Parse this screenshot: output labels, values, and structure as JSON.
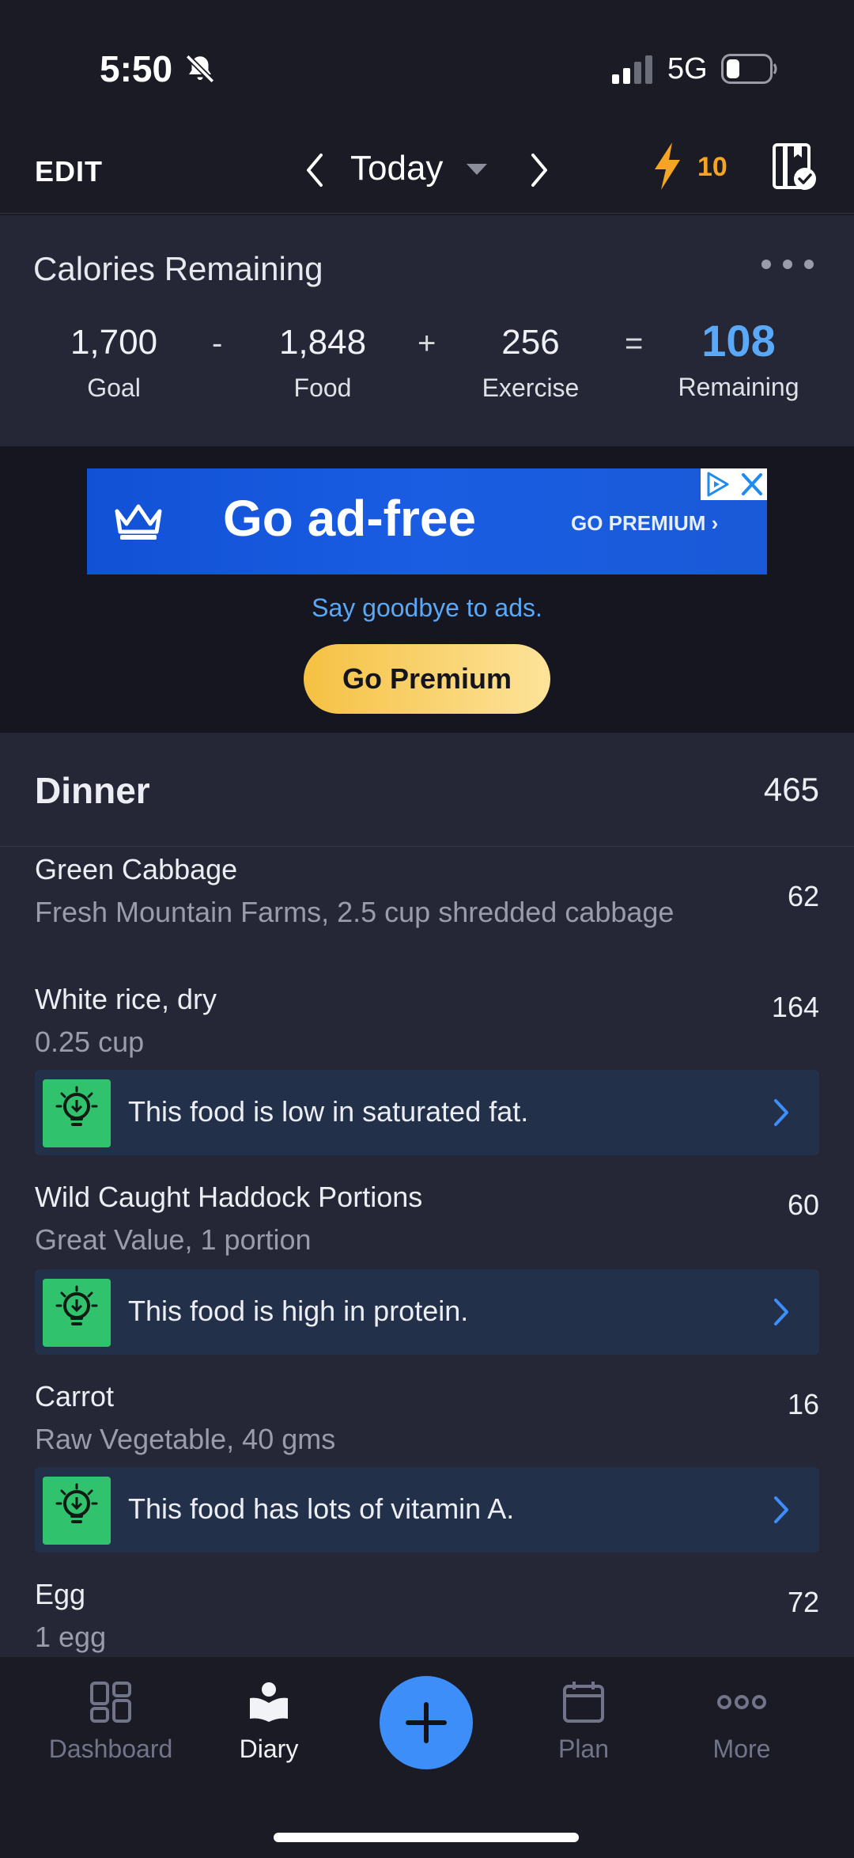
{
  "status_bar": {
    "time": "5:50",
    "network": "5G"
  },
  "header": {
    "edit_label": "EDIT",
    "date_label": "Today",
    "streak_count": "10"
  },
  "calories": {
    "title": "Calories Remaining",
    "goal": {
      "value": "1,700",
      "label": "Goal"
    },
    "food": {
      "value": "1,848",
      "label": "Food"
    },
    "exercise": {
      "value": "256",
      "label": "Exercise"
    },
    "remaining": {
      "value": "108",
      "label": "Remaining"
    },
    "op_minus": "-",
    "op_plus": "+",
    "op_equals": "="
  },
  "ad": {
    "banner_text": "Go ad-free",
    "banner_cta": "GO PREMIUM",
    "tagline": "Say goodbye to ads.",
    "button_label": "Go Premium"
  },
  "meal": {
    "title": "Dinner",
    "calories": "465",
    "items": [
      {
        "name": "Green Cabbage",
        "description": "Fresh Mountain Farms, 2.5 cup shredded cabbage",
        "calories": "62"
      },
      {
        "name": "White rice, dry",
        "description": "0.25 cup",
        "calories": "164",
        "tip": "This food is low in saturated fat."
      },
      {
        "name": "Wild Caught Haddock Portions",
        "description": "Great Value, 1 portion",
        "calories": "60",
        "tip": "This food is high in protein."
      },
      {
        "name": "Carrot",
        "description": "Raw Vegetable, 40 gms",
        "calories": "16",
        "tip": "This food has lots of vitamin A."
      },
      {
        "name": "Egg",
        "description": "1 egg",
        "calories": "72"
      }
    ]
  },
  "nav": {
    "dashboard": "Dashboard",
    "diary": "Diary",
    "plan": "Plan",
    "more": "More"
  },
  "colors": {
    "accent_blue": "#3d8ef8",
    "remaining_blue": "#5aa9f8",
    "streak_orange": "#f6a523",
    "premium_yellow": "#f5c142",
    "tip_green": "#30c26d"
  }
}
